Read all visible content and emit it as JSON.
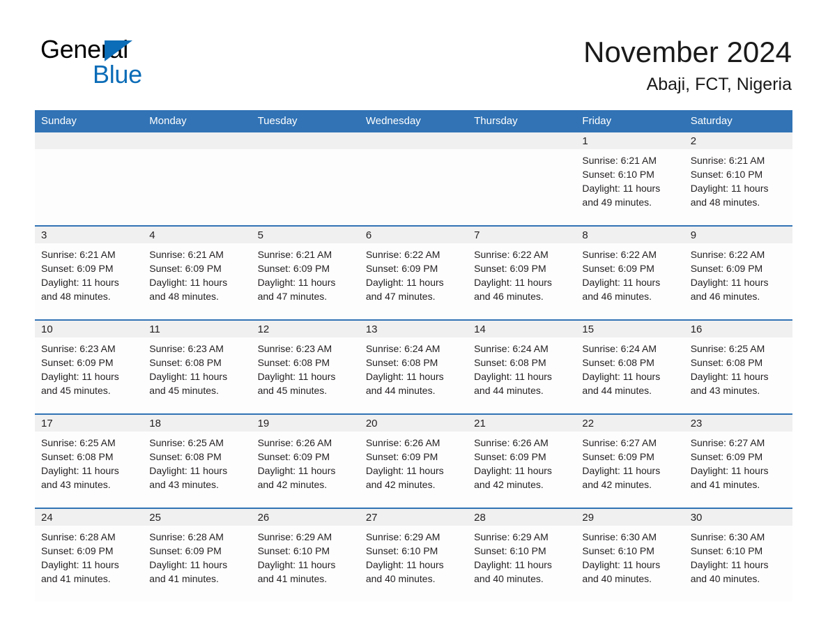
{
  "brand": {
    "line1": "General",
    "line2": "Blue",
    "triangle_color": "#0b6cb7",
    "icon": "triangle-logo-icon"
  },
  "header": {
    "title": "November 2024",
    "subtitle": "Abaji, FCT, Nigeria"
  },
  "colors": {
    "header_blue": "#3173b5",
    "row_separator": "#3173b5",
    "daynum_strip": "#f0f0f0",
    "brand_blue": "#0b6cb7",
    "text": "#231f20"
  },
  "weekday_headers": [
    "Sunday",
    "Monday",
    "Tuesday",
    "Wednesday",
    "Thursday",
    "Friday",
    "Saturday"
  ],
  "weeks": [
    [
      {
        "day": "",
        "blank": true
      },
      {
        "day": "",
        "blank": true
      },
      {
        "day": "",
        "blank": true
      },
      {
        "day": "",
        "blank": true
      },
      {
        "day": "",
        "blank": true
      },
      {
        "day": "1",
        "sunrise": "Sunrise: 6:21 AM",
        "sunset": "Sunset: 6:10 PM",
        "daylight": "Daylight: 11 hours and 49 minutes."
      },
      {
        "day": "2",
        "sunrise": "Sunrise: 6:21 AM",
        "sunset": "Sunset: 6:10 PM",
        "daylight": "Daylight: 11 hours and 48 minutes."
      }
    ],
    [
      {
        "day": "3",
        "sunrise": "Sunrise: 6:21 AM",
        "sunset": "Sunset: 6:09 PM",
        "daylight": "Daylight: 11 hours and 48 minutes."
      },
      {
        "day": "4",
        "sunrise": "Sunrise: 6:21 AM",
        "sunset": "Sunset: 6:09 PM",
        "daylight": "Daylight: 11 hours and 48 minutes."
      },
      {
        "day": "5",
        "sunrise": "Sunrise: 6:21 AM",
        "sunset": "Sunset: 6:09 PM",
        "daylight": "Daylight: 11 hours and 47 minutes."
      },
      {
        "day": "6",
        "sunrise": "Sunrise: 6:22 AM",
        "sunset": "Sunset: 6:09 PM",
        "daylight": "Daylight: 11 hours and 47 minutes."
      },
      {
        "day": "7",
        "sunrise": "Sunrise: 6:22 AM",
        "sunset": "Sunset: 6:09 PM",
        "daylight": "Daylight: 11 hours and 46 minutes."
      },
      {
        "day": "8",
        "sunrise": "Sunrise: 6:22 AM",
        "sunset": "Sunset: 6:09 PM",
        "daylight": "Daylight: 11 hours and 46 minutes."
      },
      {
        "day": "9",
        "sunrise": "Sunrise: 6:22 AM",
        "sunset": "Sunset: 6:09 PM",
        "daylight": "Daylight: 11 hours and 46 minutes."
      }
    ],
    [
      {
        "day": "10",
        "sunrise": "Sunrise: 6:23 AM",
        "sunset": "Sunset: 6:09 PM",
        "daylight": "Daylight: 11 hours and 45 minutes."
      },
      {
        "day": "11",
        "sunrise": "Sunrise: 6:23 AM",
        "sunset": "Sunset: 6:08 PM",
        "daylight": "Daylight: 11 hours and 45 minutes."
      },
      {
        "day": "12",
        "sunrise": "Sunrise: 6:23 AM",
        "sunset": "Sunset: 6:08 PM",
        "daylight": "Daylight: 11 hours and 45 minutes."
      },
      {
        "day": "13",
        "sunrise": "Sunrise: 6:24 AM",
        "sunset": "Sunset: 6:08 PM",
        "daylight": "Daylight: 11 hours and 44 minutes."
      },
      {
        "day": "14",
        "sunrise": "Sunrise: 6:24 AM",
        "sunset": "Sunset: 6:08 PM",
        "daylight": "Daylight: 11 hours and 44 minutes."
      },
      {
        "day": "15",
        "sunrise": "Sunrise: 6:24 AM",
        "sunset": "Sunset: 6:08 PM",
        "daylight": "Daylight: 11 hours and 44 minutes."
      },
      {
        "day": "16",
        "sunrise": "Sunrise: 6:25 AM",
        "sunset": "Sunset: 6:08 PM",
        "daylight": "Daylight: 11 hours and 43 minutes."
      }
    ],
    [
      {
        "day": "17",
        "sunrise": "Sunrise: 6:25 AM",
        "sunset": "Sunset: 6:08 PM",
        "daylight": "Daylight: 11 hours and 43 minutes."
      },
      {
        "day": "18",
        "sunrise": "Sunrise: 6:25 AM",
        "sunset": "Sunset: 6:08 PM",
        "daylight": "Daylight: 11 hours and 43 minutes."
      },
      {
        "day": "19",
        "sunrise": "Sunrise: 6:26 AM",
        "sunset": "Sunset: 6:09 PM",
        "daylight": "Daylight: 11 hours and 42 minutes."
      },
      {
        "day": "20",
        "sunrise": "Sunrise: 6:26 AM",
        "sunset": "Sunset: 6:09 PM",
        "daylight": "Daylight: 11 hours and 42 minutes."
      },
      {
        "day": "21",
        "sunrise": "Sunrise: 6:26 AM",
        "sunset": "Sunset: 6:09 PM",
        "daylight": "Daylight: 11 hours and 42 minutes."
      },
      {
        "day": "22",
        "sunrise": "Sunrise: 6:27 AM",
        "sunset": "Sunset: 6:09 PM",
        "daylight": "Daylight: 11 hours and 42 minutes."
      },
      {
        "day": "23",
        "sunrise": "Sunrise: 6:27 AM",
        "sunset": "Sunset: 6:09 PM",
        "daylight": "Daylight: 11 hours and 41 minutes."
      }
    ],
    [
      {
        "day": "24",
        "sunrise": "Sunrise: 6:28 AM",
        "sunset": "Sunset: 6:09 PM",
        "daylight": "Daylight: 11 hours and 41 minutes."
      },
      {
        "day": "25",
        "sunrise": "Sunrise: 6:28 AM",
        "sunset": "Sunset: 6:09 PM",
        "daylight": "Daylight: 11 hours and 41 minutes."
      },
      {
        "day": "26",
        "sunrise": "Sunrise: 6:29 AM",
        "sunset": "Sunset: 6:10 PM",
        "daylight": "Daylight: 11 hours and 41 minutes."
      },
      {
        "day": "27",
        "sunrise": "Sunrise: 6:29 AM",
        "sunset": "Sunset: 6:10 PM",
        "daylight": "Daylight: 11 hours and 40 minutes."
      },
      {
        "day": "28",
        "sunrise": "Sunrise: 6:29 AM",
        "sunset": "Sunset: 6:10 PM",
        "daylight": "Daylight: 11 hours and 40 minutes."
      },
      {
        "day": "29",
        "sunrise": "Sunrise: 6:30 AM",
        "sunset": "Sunset: 6:10 PM",
        "daylight": "Daylight: 11 hours and 40 minutes."
      },
      {
        "day": "30",
        "sunrise": "Sunrise: 6:30 AM",
        "sunset": "Sunset: 6:10 PM",
        "daylight": "Daylight: 11 hours and 40 minutes."
      }
    ]
  ]
}
